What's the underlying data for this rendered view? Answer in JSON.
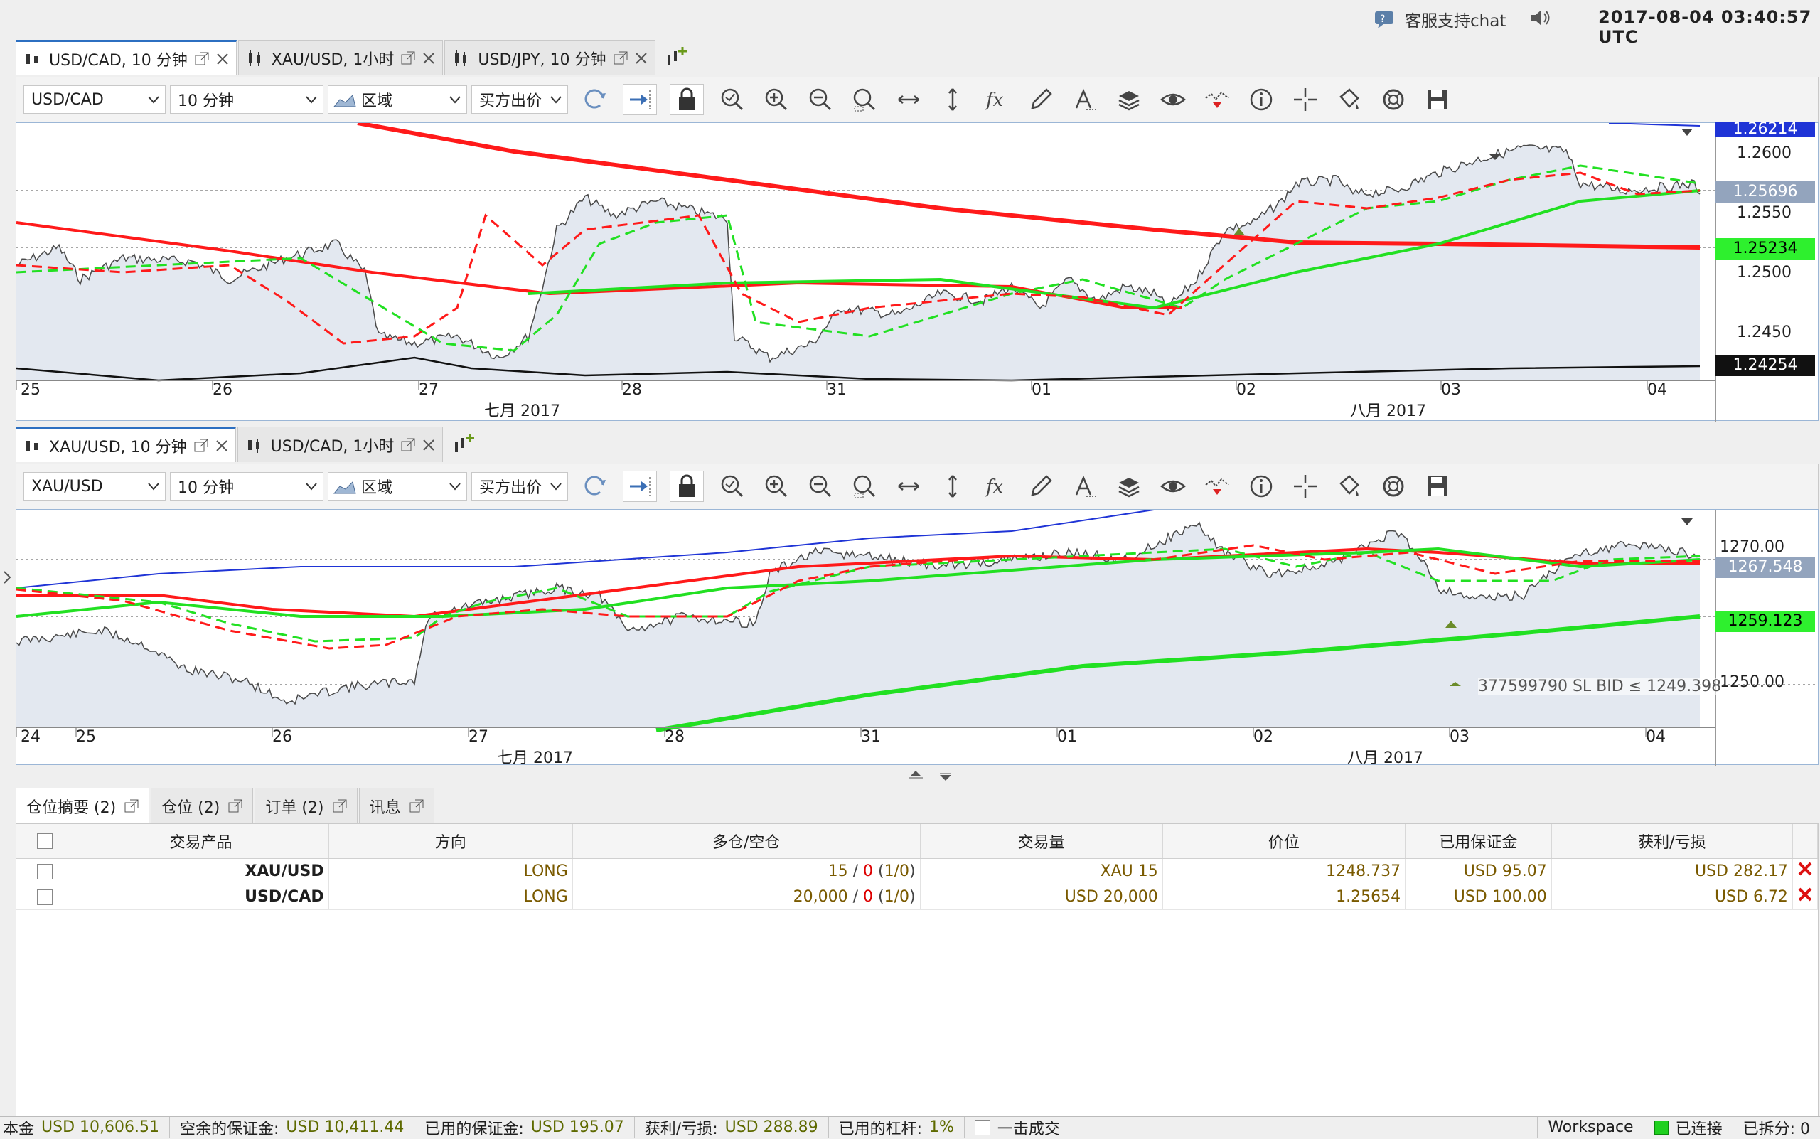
{
  "header": {
    "support_label": "客服支持chat",
    "datetime": "2017-08-04 03:40:57 UTC"
  },
  "top_tabs": [
    {
      "label": "USD/CAD, 10 分钟",
      "active": true
    },
    {
      "label": "XAU/USD, 1小时",
      "active": false
    },
    {
      "label": "USD/JPY, 10 分钟",
      "active": false
    }
  ],
  "chart1": {
    "instrument": "USD/CAD",
    "period": "10 分钟",
    "chart_type": "区域",
    "price_type": "买方出价",
    "y_ticks": [
      "1.2600",
      "1.2550",
      "1.2500",
      "1.2450"
    ],
    "price_labels": [
      {
        "text": "1.26214",
        "style": "blue"
      },
      {
        "text": "1.25696",
        "style": "gray"
      },
      {
        "text": "1.25234",
        "style": "green"
      },
      {
        "text": "1.24254",
        "style": "black"
      }
    ],
    "x_days": [
      "25",
      "26",
      "27",
      "28",
      "31",
      "01",
      "02",
      "03",
      "04"
    ],
    "months": [
      "七月 2017",
      "八月 2017"
    ]
  },
  "mid_tabs": [
    {
      "label": "XAU/USD, 10 分钟",
      "active": true
    },
    {
      "label": "USD/CAD, 1小时",
      "active": false
    }
  ],
  "chart2": {
    "instrument": "XAU/USD",
    "period": "10 分钟",
    "chart_type": "区域",
    "price_type": "买方出价",
    "y_ticks": [
      "1270.00",
      "1260.00",
      "1250.00"
    ],
    "price_labels": [
      {
        "text": "1267.548",
        "style": "gray"
      },
      {
        "text": "1259.123",
        "style": "green"
      }
    ],
    "order_line": "377599790 SL BID ≤ 1249.398",
    "x_days": [
      "24",
      "25",
      "26",
      "27",
      "28",
      "31",
      "01",
      "02",
      "03",
      "04"
    ],
    "months": [
      "七月 2017",
      "八月 2017"
    ]
  },
  "bottom_tabs": [
    {
      "label": "仓位摘要 (2)",
      "active": true
    },
    {
      "label": "仓位 (2)",
      "active": false
    },
    {
      "label": "订单 (2)",
      "active": false
    },
    {
      "label": "讯息",
      "active": false
    }
  ],
  "positions": {
    "headers": [
      "交易产品",
      "方向",
      "多仓/空仓",
      "交易量",
      "价位",
      "已用保证金",
      "获利/亏损"
    ],
    "rows": [
      {
        "product": "XAU/USD",
        "direction": "LONG",
        "pos_a": "15",
        "pos_b": "0",
        "pos_c": "1/0",
        "amount": "XAU 15",
        "price": "1248.737",
        "margin": "USD 95.07",
        "pl": "USD 282.17"
      },
      {
        "product": "USD/CAD",
        "direction": "LONG",
        "pos_a": "20,000",
        "pos_b": "0",
        "pos_c": "1/0",
        "amount": "USD 20,000",
        "price": "1.25654",
        "margin": "USD 100.00",
        "pl": "USD 6.72"
      }
    ]
  },
  "status": {
    "capital_label": "本金",
    "capital": "USD 10,606.51",
    "free_margin_label": "空余的保证金:",
    "free_margin": "USD 10,411.44",
    "used_margin_label": "已用的保证金:",
    "used_margin": "USD 195.07",
    "pl_label": "获利/亏损:",
    "pl": "USD 288.89",
    "leverage_label": "已用的杠杆:",
    "leverage": "1%",
    "oneclick_label": "一击成交",
    "workspace": "Workspace",
    "connected": "已连接",
    "splits": "已拆分: 0"
  },
  "colors": {
    "accent": "#2c6fc1",
    "ma_red": "#ff1a1a",
    "ma_green": "#22e022",
    "area": "#e3e8f0"
  }
}
